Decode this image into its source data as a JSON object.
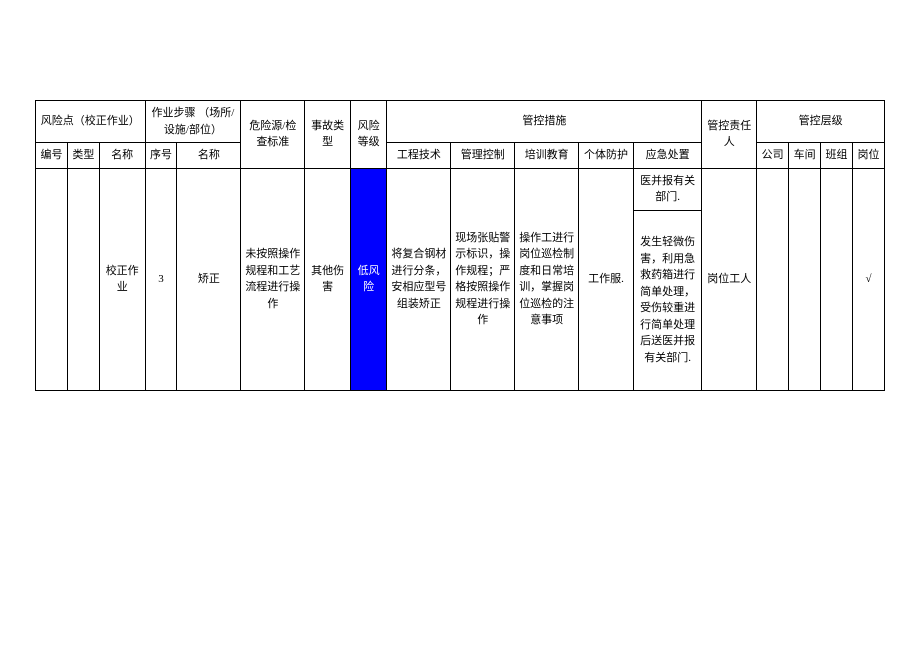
{
  "headers": {
    "risk_point": "风险点（校正作业）",
    "work_step": "作业步骤\n（场所/设施/部位）",
    "hazard_standard": "危险源/检查标准",
    "accident_type": "事故类型",
    "risk_level": "风险等级",
    "control_measures": "管控措施",
    "control_owner": "管控责任人",
    "control_level": "管控层级",
    "id": "编号",
    "type": "类型",
    "name": "名称",
    "seq": "序号",
    "step_name": "名称",
    "eng_tech": "工程技术",
    "mgmt_ctrl": "管理控制",
    "training": "培训教育",
    "ppe": "个体防护",
    "emergency": "应急处置",
    "company": "公司",
    "workshop": "车间",
    "team": "班组",
    "post": "岗位"
  },
  "row_top": {
    "emergency_top": "医并报有关部门."
  },
  "row_main": {
    "id": "",
    "type": "",
    "name": "校正作业",
    "seq": "3",
    "step_name": "矫正",
    "hazard": "未按照操作规程和工艺流程进行操作",
    "accident_type": "其他伤害",
    "risk_level": "低风险",
    "eng_tech": "将复合钢材进行分条，安相应型号组装矫正",
    "mgmt_ctrl": "现场张贴警示标识，操作规程；严格按照操作规程进行操作",
    "training": "操作工进行岗位巡检制度和日常培训，掌握岗位巡检的注意事项",
    "ppe": "工作服.",
    "emergency": "发生轻微伤害，利用急救药箱进行简单处理，受伤较重进行简单处理后送医并报有关部门.",
    "owner": "岗位工人",
    "company": "",
    "workshop": "",
    "team": "",
    "post": "√"
  }
}
